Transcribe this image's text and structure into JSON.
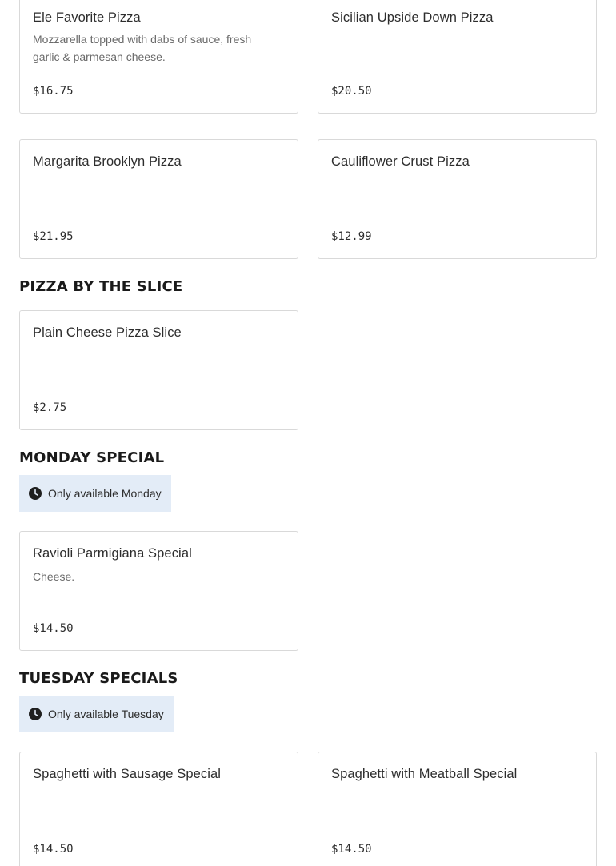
{
  "sections": {
    "pizzas": {
      "items": [
        {
          "name": "Ele Favorite Pizza",
          "description": "Mozzarella topped with dabs of sauce, fresh garlic & parmesan cheese.",
          "price": "$16.75"
        },
        {
          "name": "Sicilian Upside Down Pizza",
          "description": "",
          "price": "$20.50"
        },
        {
          "name": "Margarita Brooklyn Pizza",
          "description": "",
          "price": "$21.95"
        },
        {
          "name": "Cauliflower Crust Pizza",
          "description": "",
          "price": "$12.99"
        }
      ]
    },
    "slice": {
      "title": "PIZZA BY THE SLICE",
      "items": [
        {
          "name": "Plain Cheese Pizza Slice",
          "description": "",
          "price": "$2.75"
        }
      ]
    },
    "monday": {
      "title": "MONDAY SPECIAL",
      "availability": "Only available Monday",
      "items": [
        {
          "name": "Ravioli Parmigiana Special",
          "description": "Cheese.",
          "price": "$14.50"
        }
      ]
    },
    "tuesday": {
      "title": "TUESDAY SPECIALS",
      "availability": "Only available Tuesday",
      "items": [
        {
          "name": "Spaghetti with Sausage Special",
          "description": "",
          "price": "$14.50"
        },
        {
          "name": "Spaghetti with Meatball Special",
          "description": "",
          "price": "$14.50"
        }
      ]
    }
  },
  "icons": {
    "availability": "clock-icon"
  },
  "colors": {
    "availability_bg": "#e3ecf7",
    "card_border": "#d9d9d9",
    "heading": "#1a1a1a",
    "description": "#6a6a6a"
  }
}
